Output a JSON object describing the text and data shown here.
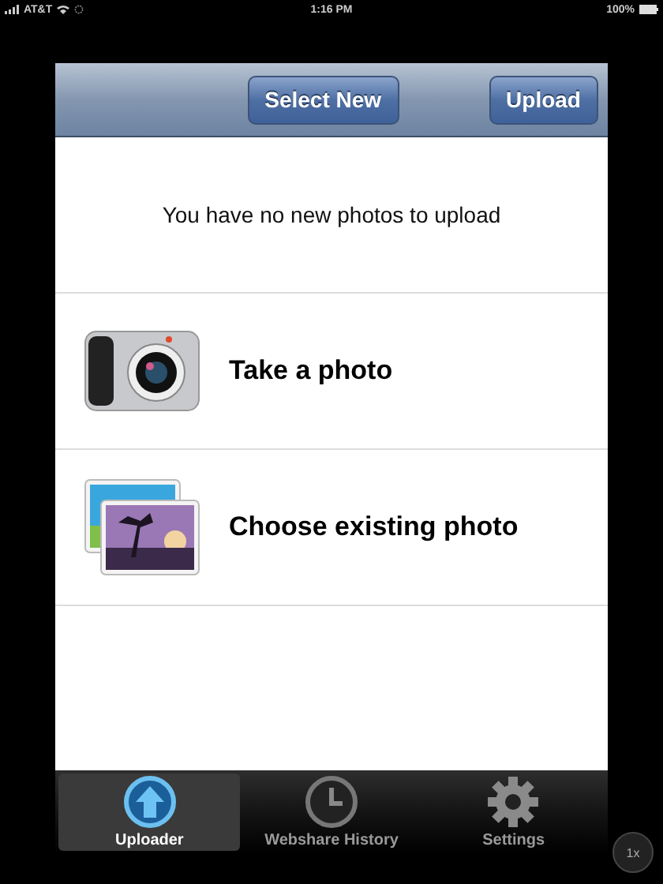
{
  "status_bar": {
    "carrier": "AT&T",
    "time": "1:16 PM",
    "battery": "100%"
  },
  "nav_bar": {
    "buttons": [
      "Select New",
      "Upload"
    ]
  },
  "message": "You have no new photos to upload",
  "actions": [
    {
      "kind": "camera",
      "label": "Take a photo"
    },
    {
      "kind": "gallery",
      "label": "Choose existing photo"
    }
  ],
  "tab_bar": [
    {
      "kind": "upload",
      "label": "Uploader",
      "selected": true
    },
    {
      "kind": "clock",
      "label": "Webshare History",
      "selected": false
    },
    {
      "kind": "gear",
      "label": "Settings",
      "selected": false
    }
  ],
  "zoom_button": "1x"
}
